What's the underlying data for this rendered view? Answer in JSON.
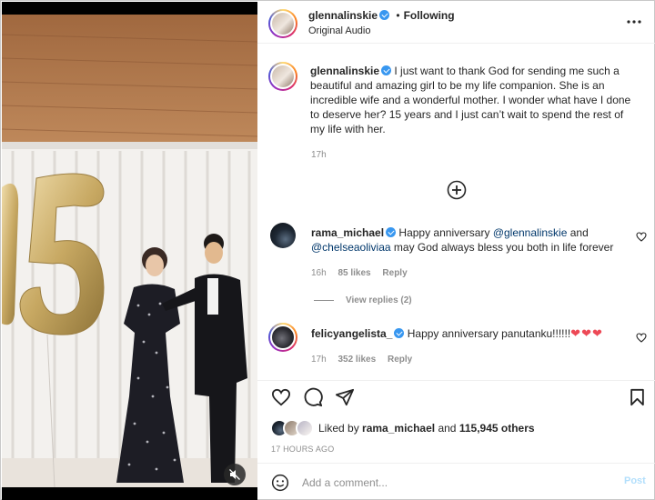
{
  "post": {
    "header": {
      "username": "glennalinskie",
      "separator": "•",
      "follow_status": "Following",
      "audio": "Original Audio"
    },
    "caption": {
      "username": "glennalinskie",
      "text": "I just want to thank God for sending me such a beautiful and amazing girl to be my life companion. She is an incredible wife and a wonderful mother. I wonder what have I done to deserve her? 15 years and I just can’t wait to spend the rest of my life with her.",
      "time": "17h"
    },
    "comments": [
      {
        "username": "rama_michael",
        "text_plain": "Happy anniversary",
        "mention1": "@glennalinskie",
        "and": "and",
        "mention2": "@chelseaoliviaa",
        "text_rest": "may God always bless you both in life forever",
        "time": "16h",
        "likes": "85 likes",
        "reply": "Reply",
        "view_replies": "View replies (2)"
      },
      {
        "username": "felicyangelista_",
        "text": "Happy anniversary panutanku!!!!!!",
        "hearts": "❤❤❤",
        "time": "17h",
        "likes": "352 likes",
        "reply": "Reply"
      }
    ],
    "likes": {
      "prefix": "Liked by",
      "user": "rama_michael",
      "and": "and",
      "others": "115,945 others"
    },
    "timestamp": "17 HOURS AGO",
    "add_comment": {
      "placeholder": "Add a comment...",
      "post_label": "Post"
    },
    "balloon_number": "15",
    "colors": {
      "verified": "#3897f0",
      "heart": "#ed4956",
      "link": "#00376b",
      "muted": "#8e8e8e",
      "post_disabled": "#b2dffc"
    },
    "icons": {
      "more": "ellipsis-icon",
      "add_more_comments": "circle-plus-icon",
      "like": "heart-outline-icon",
      "comment": "speech-bubble-icon",
      "share": "paper-plane-icon",
      "save": "bookmark-icon",
      "emoji": "smiley-icon",
      "mute": "speaker-muted-icon"
    }
  }
}
